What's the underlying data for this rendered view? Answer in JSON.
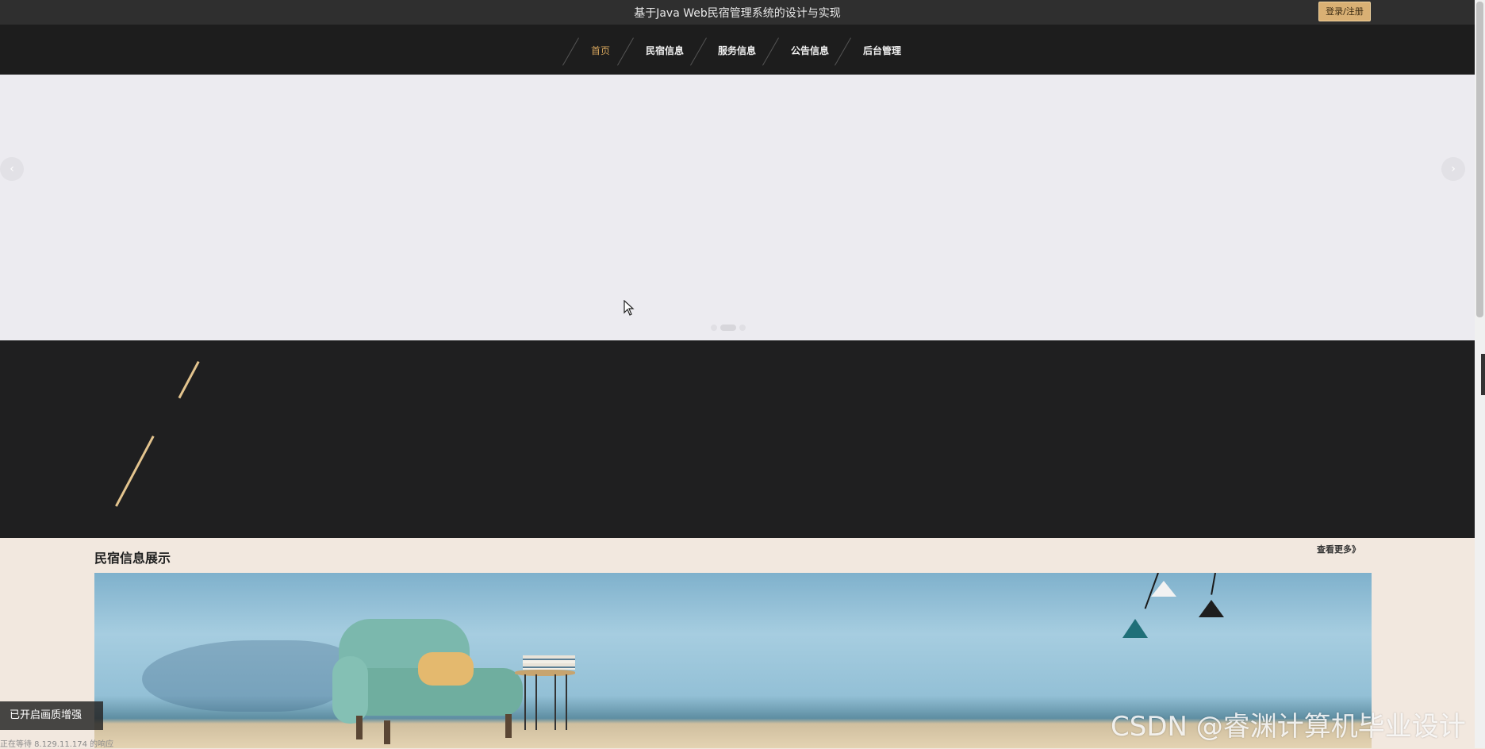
{
  "topbar": {
    "title": "基于Java Web民宿管理系统的设计与实现",
    "login_label": "登录/注册"
  },
  "nav": {
    "items": [
      {
        "label": "首页",
        "active": true
      },
      {
        "label": "民宿信息",
        "active": false
      },
      {
        "label": "服务信息",
        "active": false
      },
      {
        "label": "公告信息",
        "active": false
      },
      {
        "label": "后台管理",
        "active": false
      }
    ]
  },
  "banner": {
    "prev_icon": "chevron-left-icon",
    "next_icon": "chevron-right-icon",
    "slide_count": 3,
    "active_slide": 2
  },
  "section": {
    "title": "民宿信息展示",
    "more_label": "查看更多》"
  },
  "overlay": {
    "enhance_label": "已开启画质增强",
    "status_url": "正在等待 8.129.11.174 的响应",
    "watermark": "CSDN @睿渊计算机毕业设计"
  },
  "colors": {
    "accent": "#d4a45c",
    "login_bg": "#d9b074",
    "nav_bg": "#1d1d1d",
    "topbar_bg": "#2f2f2f",
    "section_bg": "#f2e8df"
  }
}
